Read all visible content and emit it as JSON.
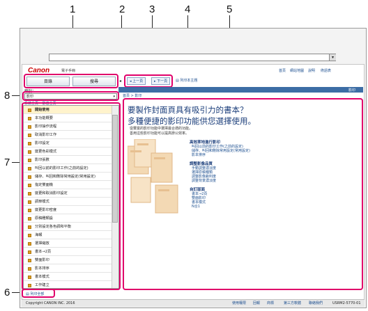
{
  "callouts": [
    "1",
    "2",
    "3",
    "4",
    "5",
    "6",
    "7",
    "8"
  ],
  "browser": {
    "menu_arrow": "▾"
  },
  "header": {
    "logo": "Canon",
    "product": "電子手冊",
    "top_links": [
      "首頁",
      "網站地圖",
      "說明",
      "術語表"
    ]
  },
  "tabs": {
    "toc": "目錄",
    "search": "搜尋"
  },
  "toolbar": {
    "prev": "上一頁",
    "next": "下一頁",
    "print": "列印本主題"
  },
  "sidebar": {
    "search_label": "類別：",
    "search_value": "影印",
    "toc_tabs": [
      "系統全頁",
      "影音全頁"
    ],
    "items": [
      "開始使用",
      "本功能概要",
      "影印操作流程",
      "取消影印工作",
      "影印設定",
      "變更色彩模式",
      "影印張數",
      "叫回以前的影印工作(之前的設定)",
      "儲存、叫回和刪除常用設定(常用設定)",
      "指定雙面機",
      "變更和取消影印設定",
      "調節模式",
      "變更影印密度",
      "原稿種類設",
      "分別設定各色調和平衡",
      "海報",
      "選擇縮放",
      "書本→2頁",
      "雙面影印",
      "影本排序",
      "書本模式",
      "工作建立"
    ],
    "print_all": "列印全部"
  },
  "content": {
    "breadcrumb": "首頁 > 影印",
    "page_tag": "影印",
    "heading_line1": "要製作封面頁具有吸引力的書本？",
    "heading_line2": "多種便捷的影印功能供您選擇使用。",
    "desc_line1": "從豐富的影印功能中選擇最合適的功能。",
    "desc_line2": "善用這些影印功能可以提高辦公效率。",
    "sections": [
      {
        "title": "高效率地進行影印",
        "links": [
          "叫回以前的影印工作(之前的設定)",
          "儲存、叫回和刪除常用設定(常用設定)",
          "影本排序"
        ]
      },
      {
        "title": "調整影像品質",
        "links": [
          "手動調整濃淡度",
          "選擇原稿種類",
          "調整影像銳利度",
          "調整背景濃淡度"
        ]
      },
      {
        "title": "自訂版面",
        "links": [
          "書本→2頁",
          "雙面影印",
          "書本模式",
          "N合1"
        ]
      }
    ]
  },
  "footer": {
    "copyright": "Copyright CANON INC. 2016",
    "links": [
      "使用權限",
      "回報",
      "商標",
      "第三方軟體",
      "聯絡我們"
    ],
    "code": "USRM2-5770-01"
  },
  "colors": {
    "callout_frame": "#e0006a",
    "accent": "#3c6da5",
    "brand": "#cc0000"
  }
}
